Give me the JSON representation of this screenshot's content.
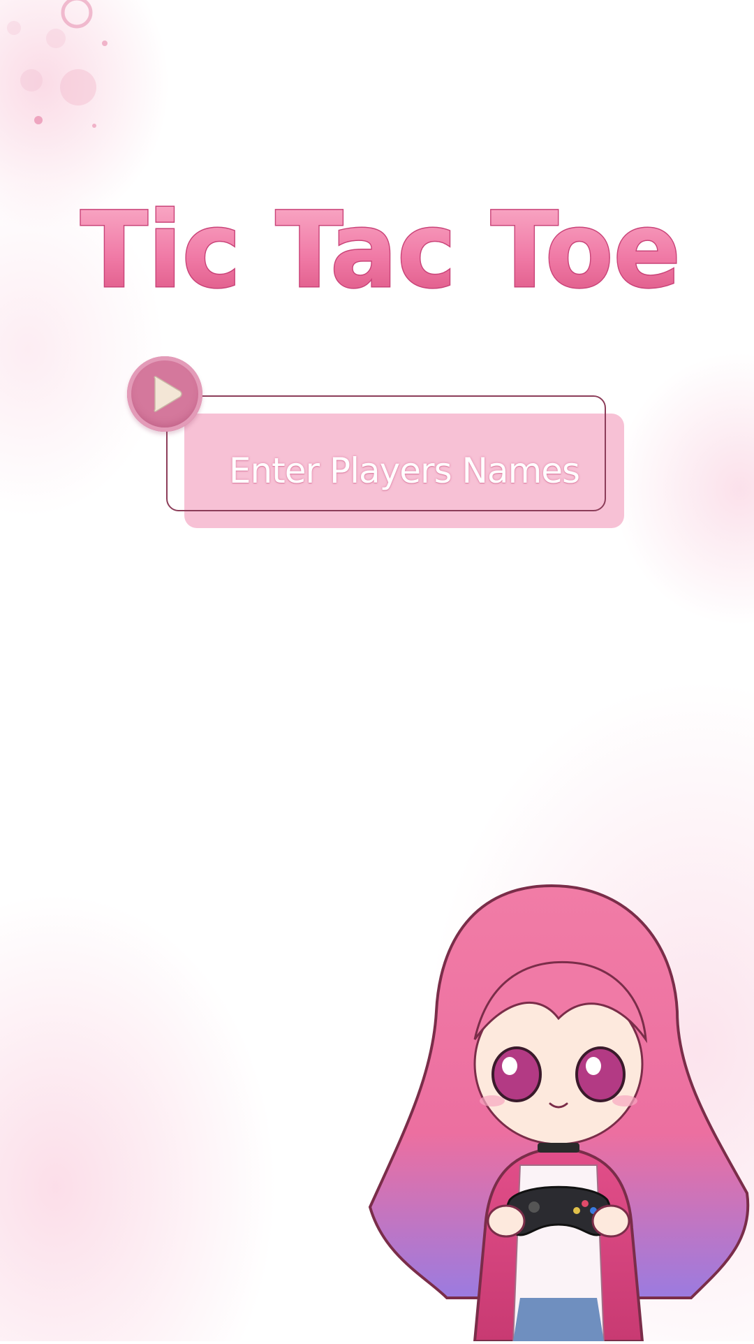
{
  "title": "Tic Tac Toe",
  "menu": {
    "enter_players_label": "Enter Players Names"
  },
  "icons": {
    "play": "play-icon",
    "character": "anime-girl-with-gamepad-illustration"
  },
  "colors": {
    "title_pink": "#f07aa6",
    "button_fill": "#f7c1d5",
    "button_border": "#8c3d59",
    "play_circle": "#d4789c",
    "play_triangle": "#f3e6d6"
  }
}
